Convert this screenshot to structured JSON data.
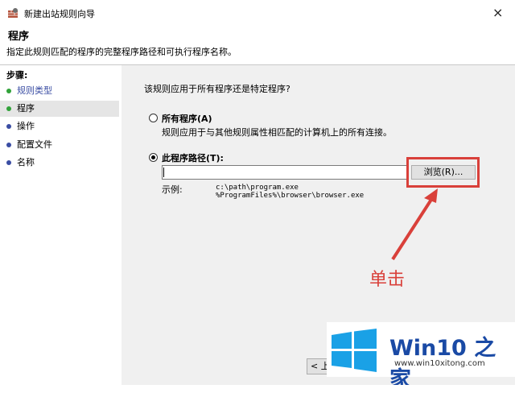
{
  "window": {
    "title": "新建出站规则向导",
    "close_glyph": "×",
    "app_icon": "firewall-wall-icon"
  },
  "header": {
    "page_title": "程序",
    "page_desc": "指定此规则匹配的程序的完整程序路径和可执行程序名称。"
  },
  "sidebar": {
    "steps_label": "步骤:",
    "items": [
      {
        "label": "规则类型",
        "state": "done",
        "color": "#31a23a"
      },
      {
        "label": "程序",
        "state": "current",
        "color": "#31a23a"
      },
      {
        "label": "操作",
        "state": "pending",
        "color": "#3a4da3"
      },
      {
        "label": "配置文件",
        "state": "pending",
        "color": "#3a4da3"
      },
      {
        "label": "名称",
        "state": "pending",
        "color": "#3a4da3"
      }
    ]
  },
  "main": {
    "question": "该规则应用于所有程序还是特定程序?",
    "option_all": {
      "label": "所有程序(A)",
      "desc": "规则应用于与其他规则属性相匹配的计算机上的所有连接。",
      "checked": false
    },
    "option_path": {
      "label": "此程序路径(T):",
      "checked": true
    },
    "path_value": "",
    "browse_label": "浏览(R)...",
    "example_label": "示例:",
    "example_lines": [
      "c:\\path\\program.exe",
      "%ProgramFiles%\\browser\\browser.exe"
    ],
    "back_label": "< 上"
  },
  "annotation": {
    "text": "单击",
    "color": "#d9403a"
  },
  "watermark": {
    "brand": "Win10 之家",
    "url": "www.win10xitong.com",
    "brand_color": "#1a4aa5"
  }
}
